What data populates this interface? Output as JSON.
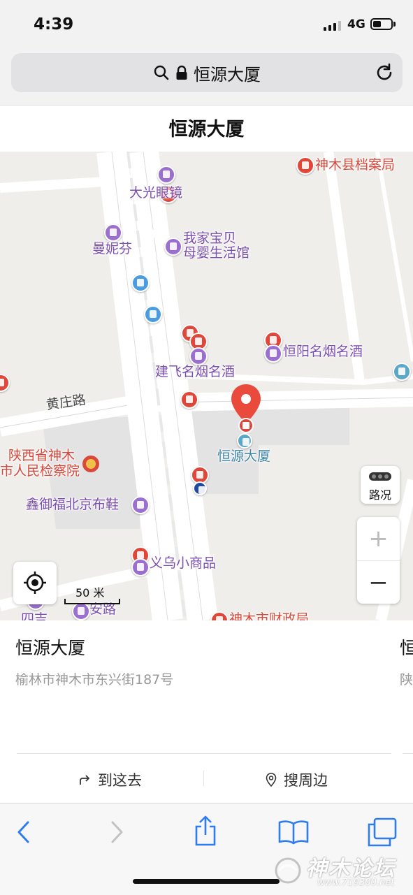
{
  "status_bar": {
    "time": "4:39",
    "network": "4G",
    "signal_bars": 3,
    "battery_level": 0.45
  },
  "browser": {
    "address_text": "恒源大厦"
  },
  "page": {
    "title": "恒源大厦"
  },
  "map": {
    "road_label": "黄庄路",
    "marker_label": "恒源大厦",
    "traffic_button": "路况",
    "zoom_in": "+",
    "zoom_out": "−",
    "scale_label": "50 米",
    "pois": {
      "archives": "神木县档案局",
      "glasses": "大光眼镜",
      "manifen": "曼妮芬",
      "baby_line1": "我家宝贝",
      "baby_line2": "母婴生活馆",
      "jianfei": "建飞名烟名酒",
      "hengyang": "恒阳名烟名酒",
      "procuratorate_line1": "陕西省神木",
      "procuratorate_line2": "市人民检察院",
      "shoes": "鑫御福北京布鞋",
      "yiwu": "义乌小商品",
      "anlu": "安路",
      "partial_left": "四吉",
      "finance": "神木市财政局"
    },
    "colors": {
      "purple": "#7b4fb0",
      "red": "#d9483b",
      "marker": "#e94a3c"
    }
  },
  "card": {
    "name": "恒源大厦",
    "address": "榆林市神木市东兴街187号",
    "peek_name": "恒",
    "peek_address": "陕",
    "go_label": "到这去",
    "nearby_label": "搜周边"
  },
  "toolbar": {
    "icons": [
      "back-icon",
      "forward-icon",
      "share-icon",
      "bookmarks-icon",
      "tabs-icon"
    ]
  },
  "watermark": {
    "title": "神木论坛",
    "url": "www.719300.net"
  }
}
